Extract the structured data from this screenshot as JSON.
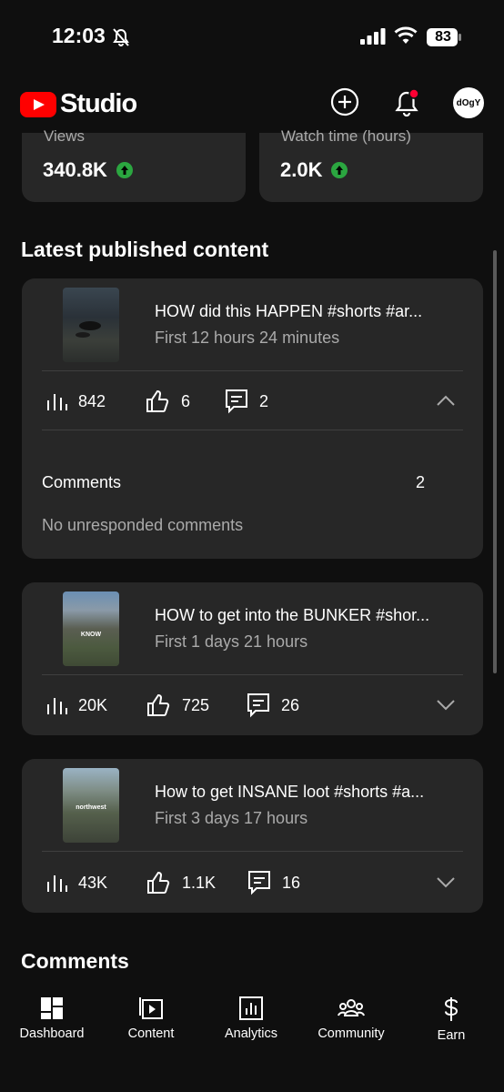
{
  "status_bar": {
    "time": "12:03",
    "battery": "83"
  },
  "header": {
    "app_name": "Studio",
    "avatar_text": "dOgY"
  },
  "stats": [
    {
      "label": "Views",
      "value": "340.8K"
    },
    {
      "label": "Watch time (hours)",
      "value": "2.0K"
    }
  ],
  "latest": {
    "title": "Latest published content",
    "videos": [
      {
        "title": "HOW did this HAPPEN #shorts #ar...",
        "subtitle": "First 12 hours 24 minutes",
        "views": "842",
        "likes": "6",
        "comments": "2",
        "expanded": true,
        "comments_label": "Comments",
        "comments_count": "2",
        "comments_status": "No unresponded comments"
      },
      {
        "title": "HOW to get into the BUNKER #shor...",
        "subtitle": "First 1 days 21 hours",
        "views": "20K",
        "likes": "725",
        "comments": "26",
        "expanded": false,
        "thumb_text": "KNOW"
      },
      {
        "title": "How to get INSANE loot #shorts #a...",
        "subtitle": "First 3 days 17 hours",
        "views": "43K",
        "likes": "1.1K",
        "comments": "16",
        "expanded": false,
        "thumb_text": "northwest"
      }
    ]
  },
  "comments_section": {
    "title": "Comments"
  },
  "nav": [
    {
      "label": "Dashboard",
      "icon": "dashboard-icon"
    },
    {
      "label": "Content",
      "icon": "content-icon"
    },
    {
      "label": "Analytics",
      "icon": "analytics-icon"
    },
    {
      "label": "Community",
      "icon": "community-icon"
    },
    {
      "label": "Earn",
      "icon": "dollar-icon"
    }
  ],
  "colors": {
    "background": "#0f0f0f",
    "card": "#272727",
    "accent": "#ff0000",
    "up_green": "#2ba640"
  }
}
